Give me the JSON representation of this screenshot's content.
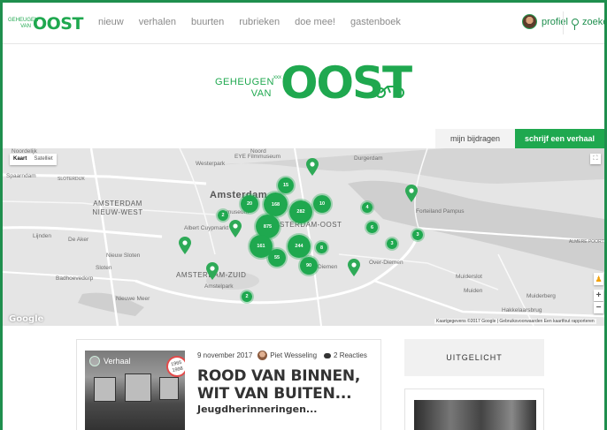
{
  "nav": {
    "logo_small": "GEHEUGEN VAN",
    "logo_big": "OOST",
    "links": [
      "nieuw",
      "verhalen",
      "buurten",
      "rubrieken",
      "doe mee!",
      "gastenboek"
    ],
    "profile": "profiel",
    "search": "zoeken"
  },
  "hero": {
    "line1": "GEHEUGEN",
    "line2": "VAN",
    "x_marks": "xxx",
    "logo": "OOST"
  },
  "tabs": {
    "mine": "mijn bijdragen",
    "write": "schrijf een verhaal"
  },
  "map": {
    "type_map": "Kaart",
    "type_sat": "Satelliet",
    "google": "Google",
    "attribution": "Kaartgegevens ©2017 Google | Gebruiksvoorwaarden   Een kaartfout rapporteren",
    "labels": {
      "noordelijk": "Noordelijk",
      "spaarndam": "Spaarndam",
      "westerpark": "Westerpark",
      "eye": "EYE Filmmuseum",
      "noord": "Noord",
      "durgerdam": "Durgerdam",
      "amsterdam": "Amsterdam",
      "museum": "museum",
      "nieuwwest": "AMSTERDAM NIEUW-WEST",
      "cuyp": "Albert Cuypmarkt",
      "oost": "AMSTERDAM-OOST",
      "forteiland": "Forteiland Pampus",
      "lijnden": "Lijnden",
      "deaker": "De Aker",
      "nieuwsloten": "Nieuw Sloten",
      "sloten": "Sloten",
      "badhoevedorp": "Badhoevedorp",
      "zuid": "AMSTERDAM-ZUID",
      "amstelpark": "Amstelpark",
      "diemen": "Diemen",
      "overdiemen": "Over-Diemen",
      "nieuwemeer": "Nieuwe Meer",
      "muiderslot": "Muiderslot",
      "muiden": "Muiden",
      "muiderberg": "Muiderberg",
      "hakkelaarsbrug": "Hakkelaarsbrug",
      "almere": "ALMERE POORT",
      "sloterdijk": "SLOTERDIJK"
    },
    "clusters": [
      "15",
      "20",
      "168",
      "282",
      "10",
      "2",
      "875",
      "161",
      "244",
      "55",
      "90",
      "4",
      "6",
      "3",
      "3",
      "8",
      "2"
    ]
  },
  "story": {
    "type": "Verhaal",
    "year_badge": "1965 1998",
    "date": "9 november 2017",
    "author": "Piet Wesseling",
    "reactions": "2 Reacties",
    "title": "ROOD VAN BINNEN, WIT VAN BUITEN...",
    "subtitle": "Jeugdherinneringen..."
  },
  "featured": {
    "heading": "UITGELICHT"
  }
}
